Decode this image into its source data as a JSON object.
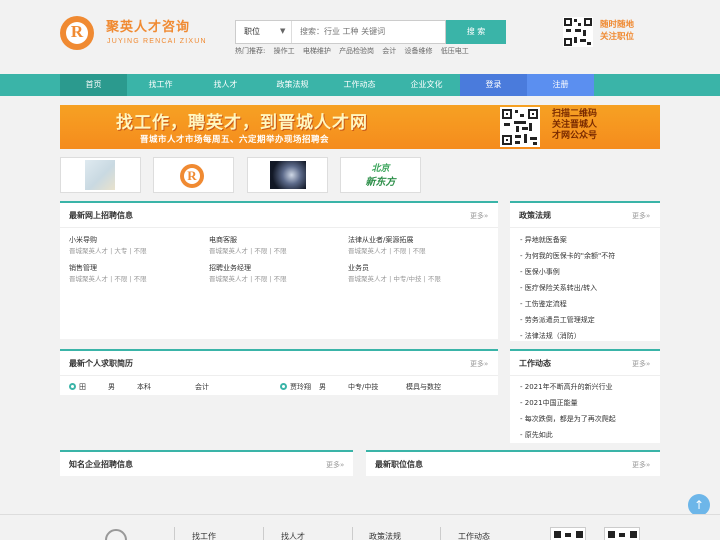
{
  "brand": {
    "name_cn": "聚英人才咨询",
    "name_en": "JUYING RENCAI ZIXUN",
    "logo_letter": "R",
    "accent": "#f08a32",
    "theme": "#3ab4a8"
  },
  "search": {
    "select_value": "职位",
    "placeholder": "搜索：行业 工种 关键词",
    "button": "搜 索"
  },
  "hot": {
    "label": "热门推荐:",
    "items": [
      "操作工",
      "电梯维护",
      "产品检验岗",
      "会计",
      "设备维修",
      "低压电工"
    ]
  },
  "qr_text": {
    "line1": "随时随地",
    "line2": "关注职位"
  },
  "nav": {
    "items": [
      "首页",
      "找工作",
      "找人才",
      "政策法规",
      "工作动态",
      "企业文化"
    ],
    "login": "登录",
    "register": "注册"
  },
  "banner": {
    "title": "找工作，聘英才，到晋城人才网",
    "subtitle": "晋城市人才市场每周五、六定期举办现场招聘会",
    "qr_line1": "扫描二维码",
    "qr_line2": "关注晋城人",
    "qr_line3": "才网公众号"
  },
  "thumbs": {
    "xdf_top": "北京",
    "xdf_bottom": "新东方"
  },
  "jobs_panel": {
    "title": "最新网上招聘信息",
    "more": "更多»",
    "items": [
      {
        "title": "小米导购",
        "meta": "晋城聚英人才 | 大专 | 不限"
      },
      {
        "title": "电商客服",
        "meta": "晋城聚英人才 | 不限 | 不限"
      },
      {
        "title": "法律从业者/案源拓展",
        "meta": "晋城聚英人才 | 不限 | 不限"
      },
      {
        "title": "销售管理",
        "meta": "晋城聚英人才 | 不限 | 不限"
      },
      {
        "title": "招聘业务经理",
        "meta": "晋城聚英人才 | 不限 | 不限"
      },
      {
        "title": "业务员",
        "meta": "晋城聚英人才 | 中专/中技 | 不限"
      }
    ]
  },
  "policy_panel": {
    "title": "政策法规",
    "more": "更多»",
    "items": [
      "- 异地就医备案",
      "- 为何我的医保卡的\"余额\"不符",
      "- 医保小事例",
      "- 医疗保险关系转出/转入",
      "- 工伤鉴定流程",
      "- 劳务派遣员工管理规定",
      "- 法律法规（消防）"
    ]
  },
  "resume_panel": {
    "title": "最新个人求职简历",
    "more": "更多»",
    "rows": [
      {
        "name": "田",
        "gender": "男",
        "edu": "本科",
        "major": "会计"
      },
      {
        "name": "贾玲翔",
        "gender": "男",
        "edu": "中专/中技",
        "major": "模具与数控"
      }
    ]
  },
  "news_panel": {
    "title": "工作动态",
    "more": "更多»",
    "items": [
      "- 2021年不断高升的新兴行业",
      "- 2021中国正能量",
      "- 每次跌倒，都是为了再次爬起",
      "- 原先如此"
    ]
  },
  "company_panel": {
    "title": "知名企业招聘信息",
    "more": "更多»"
  },
  "latest_panel": {
    "title": "最新职位信息",
    "more": "更多»"
  },
  "footer": {
    "links": [
      "找工作",
      "找人才",
      "政策法规",
      "工作动态"
    ]
  }
}
